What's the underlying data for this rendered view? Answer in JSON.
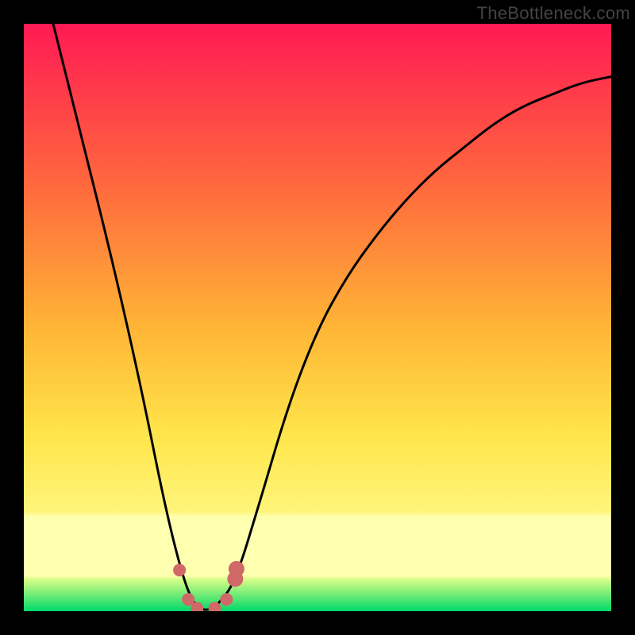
{
  "watermark": "TheBottleneck.com",
  "chart_data": {
    "type": "line",
    "title": "",
    "xlabel": "",
    "ylabel": "",
    "x_range": [
      0,
      1
    ],
    "y_range": [
      0,
      1
    ],
    "grid": false,
    "legend": false,
    "gradient": {
      "top": "#ff0040",
      "mid1": "#ffa633",
      "mid2": "#ffe54a",
      "band_pale": "#ffffb0",
      "bottom": "#00e676"
    },
    "series": [
      {
        "name": "bottleneck-curve",
        "type": "line",
        "x": [
          0.05,
          0.1,
          0.15,
          0.2,
          0.24,
          0.27,
          0.29,
          0.31,
          0.33,
          0.36,
          0.4,
          0.45,
          0.5,
          0.55,
          0.6,
          0.65,
          0.7,
          0.75,
          0.8,
          0.85,
          0.9,
          0.95,
          1.0
        ],
        "y": [
          1.0,
          0.8,
          0.6,
          0.38,
          0.18,
          0.06,
          0.01,
          0.0,
          0.01,
          0.05,
          0.18,
          0.35,
          0.48,
          0.57,
          0.64,
          0.7,
          0.75,
          0.79,
          0.83,
          0.86,
          0.88,
          0.9,
          0.91
        ]
      },
      {
        "name": "markers",
        "type": "scatter",
        "color": "#d06868",
        "points": [
          {
            "x": 0.265,
            "y": 0.07,
            "r": 8
          },
          {
            "x": 0.28,
            "y": 0.02,
            "r": 8
          },
          {
            "x": 0.295,
            "y": 0.005,
            "r": 8
          },
          {
            "x": 0.325,
            "y": 0.005,
            "r": 8
          },
          {
            "x": 0.345,
            "y": 0.02,
            "r": 8
          },
          {
            "x": 0.36,
            "y": 0.055,
            "r": 10
          },
          {
            "x": 0.362,
            "y": 0.072,
            "r": 10
          }
        ]
      }
    ]
  }
}
